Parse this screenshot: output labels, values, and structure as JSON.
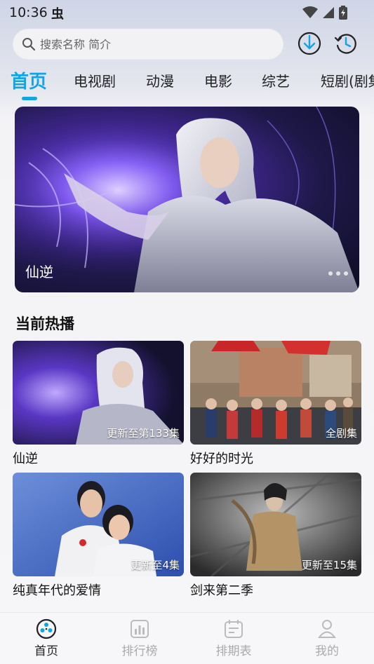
{
  "status": {
    "time": "10:36",
    "app_glyph": "虫"
  },
  "search": {
    "placeholder": "搜索名称 简介"
  },
  "tabs": [
    {
      "label": "首页",
      "active": true
    },
    {
      "label": "电视剧"
    },
    {
      "label": "动漫"
    },
    {
      "label": "电影"
    },
    {
      "label": "综艺"
    },
    {
      "label": "短剧(剧集"
    }
  ],
  "banner": {
    "title": "仙逆"
  },
  "section": {
    "title": "当前热播"
  },
  "cards": [
    {
      "title": "仙逆",
      "badge": "更新至第133集"
    },
    {
      "title": "好好的时光",
      "badge": "全剧集"
    },
    {
      "title": "纯真年代的爱情",
      "badge": "更新至4集"
    },
    {
      "title": "剑来第二季",
      "badge": "更新至15集"
    }
  ],
  "bottom_nav": [
    {
      "label": "首页",
      "icon": "home-reel-icon",
      "active": true
    },
    {
      "label": "排行榜",
      "icon": "ranking-icon"
    },
    {
      "label": "排期表",
      "icon": "schedule-icon"
    },
    {
      "label": "我的",
      "icon": "profile-icon"
    }
  ],
  "colors": {
    "accent": "#12a5e6",
    "inactive_nav": "#aaaaaa"
  }
}
